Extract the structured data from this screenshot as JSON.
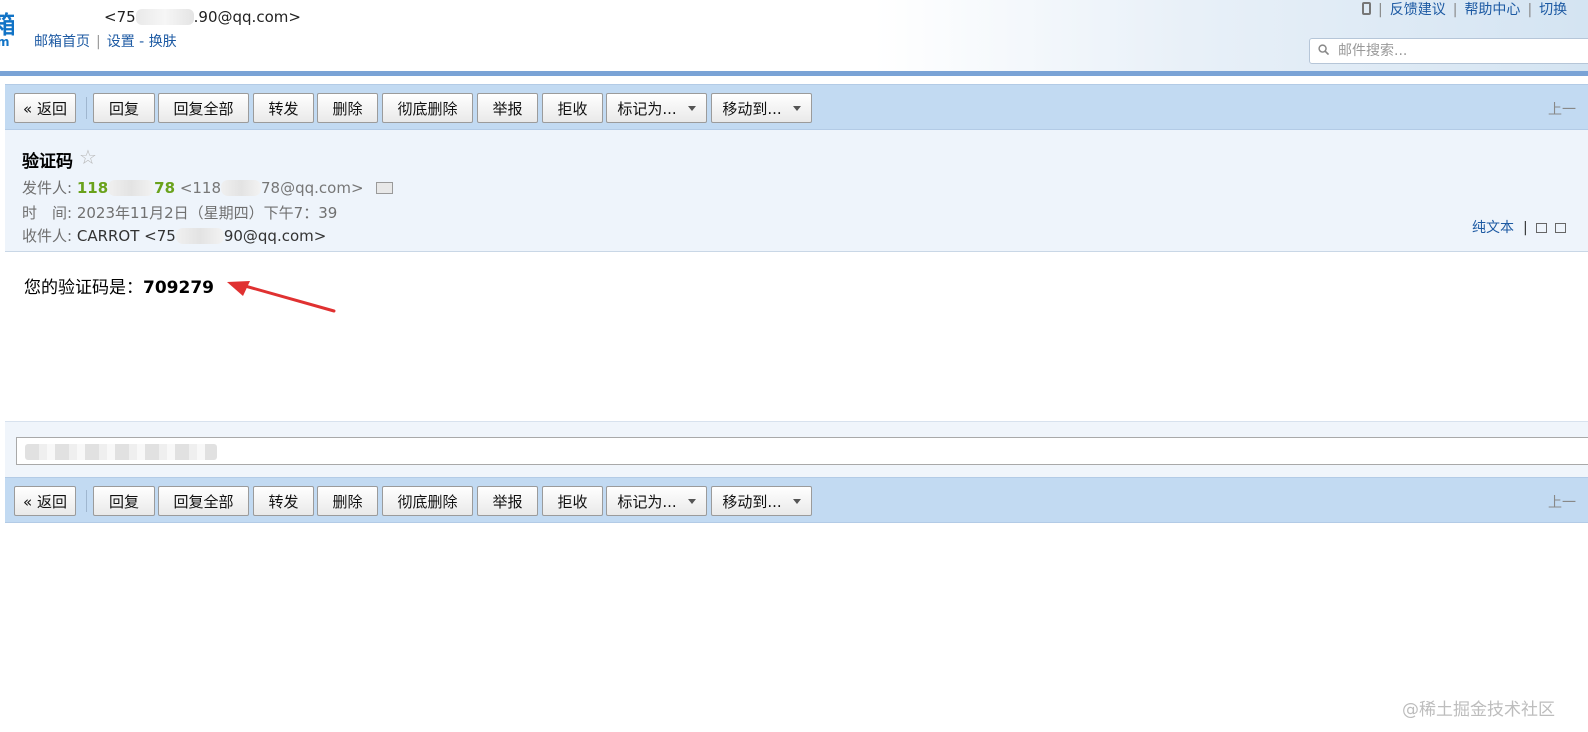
{
  "header": {
    "logo_glyph": "箱",
    "logo_sub": "m",
    "account_prefix": "<75",
    "account_suffix": ".90@qq.com>",
    "nav": {
      "home": "邮箱首页",
      "settings": "设置",
      "dash": "-",
      "skin": "换肤"
    },
    "right": {
      "feedback": "反馈建议",
      "help": "帮助中心",
      "switch": "切换"
    },
    "search_placeholder": "邮件搜索..."
  },
  "toolbar": {
    "back": "« 返回",
    "reply": "回复",
    "reply_all": "回复全部",
    "forward": "转发",
    "delete": "删除",
    "delete_permanently": "彻底删除",
    "report": "举报",
    "reject": "拒收",
    "mark_as": "标记为...",
    "move_to": "移动到...",
    "prev": "上一"
  },
  "mail": {
    "subject": "验证码",
    "from_label": "发件人:",
    "from_name_prefix": "118",
    "from_name_suffix": "78",
    "from_addr_prefix": "<118",
    "from_addr_suffix": "78@qq.com>",
    "time_label": "时　间:",
    "time_value": "2023年11月2日（星期四）下午7：39",
    "to_label": "收件人:",
    "to_value_prefix": "CARROT <75",
    "to_value_suffix": "90@qq.com>",
    "plain_text": "纯文本",
    "plain_sep": "|",
    "body_prefix": "您的验证码是：",
    "code": "709279"
  },
  "watermark": "@稀土掘金技术社区",
  "colors": {
    "toolbar_bg": "#c2daf2",
    "header_bg": "#eef4fb",
    "link": "#1d5aa3",
    "sender_green": "#6aa21c",
    "arrow_red": "#e03131"
  }
}
